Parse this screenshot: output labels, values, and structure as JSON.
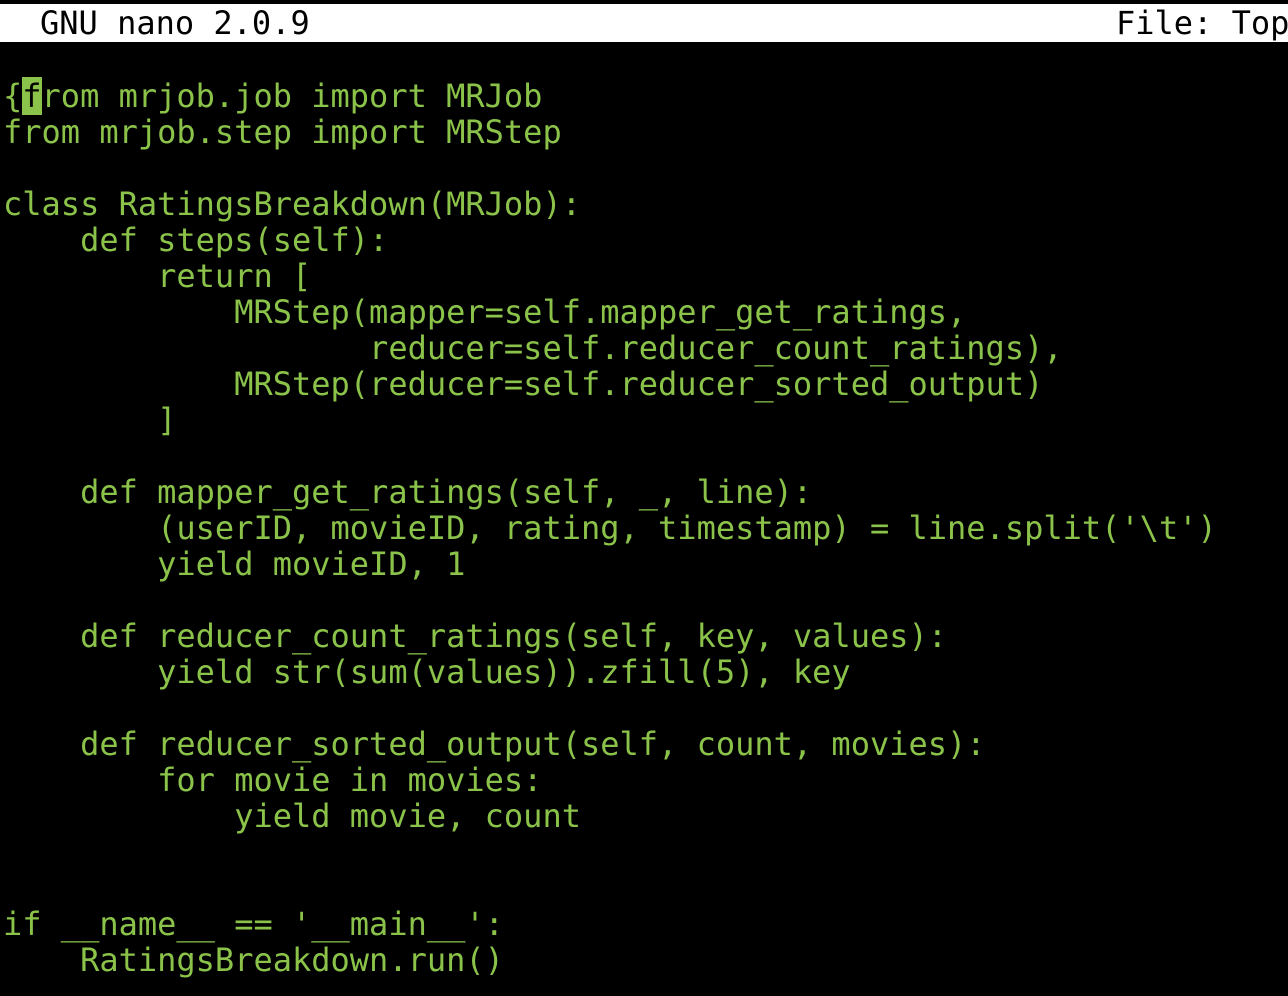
{
  "titlebar": {
    "app": "GNU nano 2.0.9",
    "file": "File: Top"
  },
  "colors": {
    "background": "#000000",
    "text": "#8bc34a",
    "titlebar_bg": "#ffffff",
    "titlebar_fg": "#000000"
  },
  "cursor": {
    "line": 1,
    "column": 2,
    "char": "f"
  },
  "lines": [
    "{from mrjob.job import MRJob",
    "from mrjob.step import MRStep",
    "",
    "class RatingsBreakdown(MRJob):",
    "    def steps(self):",
    "        return [",
    "            MRStep(mapper=self.mapper_get_ratings,",
    "                   reducer=self.reducer_count_ratings),",
    "            MRStep(reducer=self.reducer_sorted_output)",
    "        ]",
    "",
    "    def mapper_get_ratings(self, _, line):",
    "        (userID, movieID, rating, timestamp) = line.split('\\t')",
    "        yield movieID, 1",
    "",
    "    def reducer_count_ratings(self, key, values):",
    "        yield str(sum(values)).zfill(5), key",
    "",
    "    def reducer_sorted_output(self, count, movies):",
    "        for movie in movies:",
    "            yield movie, count",
    "",
    "",
    "if __name__ == '__main__':",
    "    RatingsBreakdown.run()"
  ]
}
